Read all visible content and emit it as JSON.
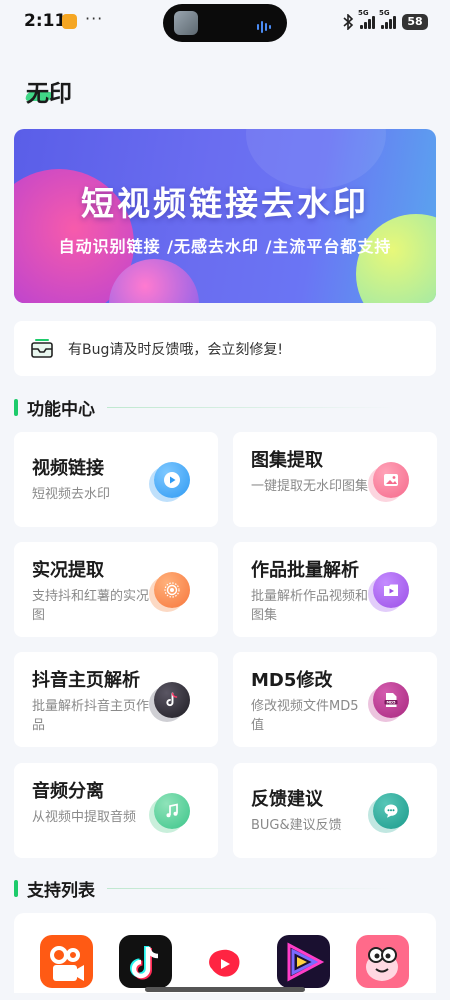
{
  "status_bar": {
    "time": "2:11",
    "more": "···",
    "network_a": "5G",
    "network_b": "5G",
    "battery": "58"
  },
  "app": {
    "title": "无印"
  },
  "banner": {
    "title": "短视频链接去水印",
    "subtitle": "自动识别链接 /无感去水印 /主流平台都支持"
  },
  "notice": {
    "text": "有Bug请及时反馈哦，会立刻修复!"
  },
  "sections": {
    "features": "功能中心",
    "support": "支持列表"
  },
  "features": [
    {
      "title": "视频链接",
      "desc": "短视频去水印",
      "icon": "play-icon",
      "color": "#2f9af3"
    },
    {
      "title": "图集提取",
      "desc": "一键提取无水印图集",
      "icon": "image-icon",
      "color": "#f56a8c"
    },
    {
      "title": "实况提取",
      "desc": "支持抖和红薯的实况图",
      "icon": "live-photo-icon",
      "color": "#f7773d"
    },
    {
      "title": "作品批量解析",
      "desc": "批量解析作品视频和图集",
      "icon": "video-folder-icon",
      "color": "#9b50e6"
    },
    {
      "title": "抖音主页解析",
      "desc": "批量解析抖音主页作品",
      "icon": "tiktok-icon",
      "color": "#33303a"
    },
    {
      "title": "MD5修改",
      "desc": "修改视频文件MD5值",
      "icon": "md5-file-icon",
      "color": "#a8287f"
    },
    {
      "title": "音频分离",
      "desc": "从视频中提取音频",
      "icon": "music-note-icon",
      "color": "#3cc58a"
    },
    {
      "title": "反馈建议",
      "desc": "BUG&建议反馈",
      "icon": "chat-bubble-icon",
      "color": "#1b9b8c"
    }
  ],
  "platforms": [
    {
      "name": "kuaishou-logo-icon",
      "color": "#ff5a14"
    },
    {
      "name": "douyin-logo-icon",
      "color": "#111111"
    },
    {
      "name": "xiaohongshu-logo-icon",
      "color": "#ff2442"
    },
    {
      "name": "video-app-logo-icon",
      "color": "#1a1030"
    },
    {
      "name": "pipixia-logo-icon",
      "color": "#ff6a8a"
    }
  ]
}
